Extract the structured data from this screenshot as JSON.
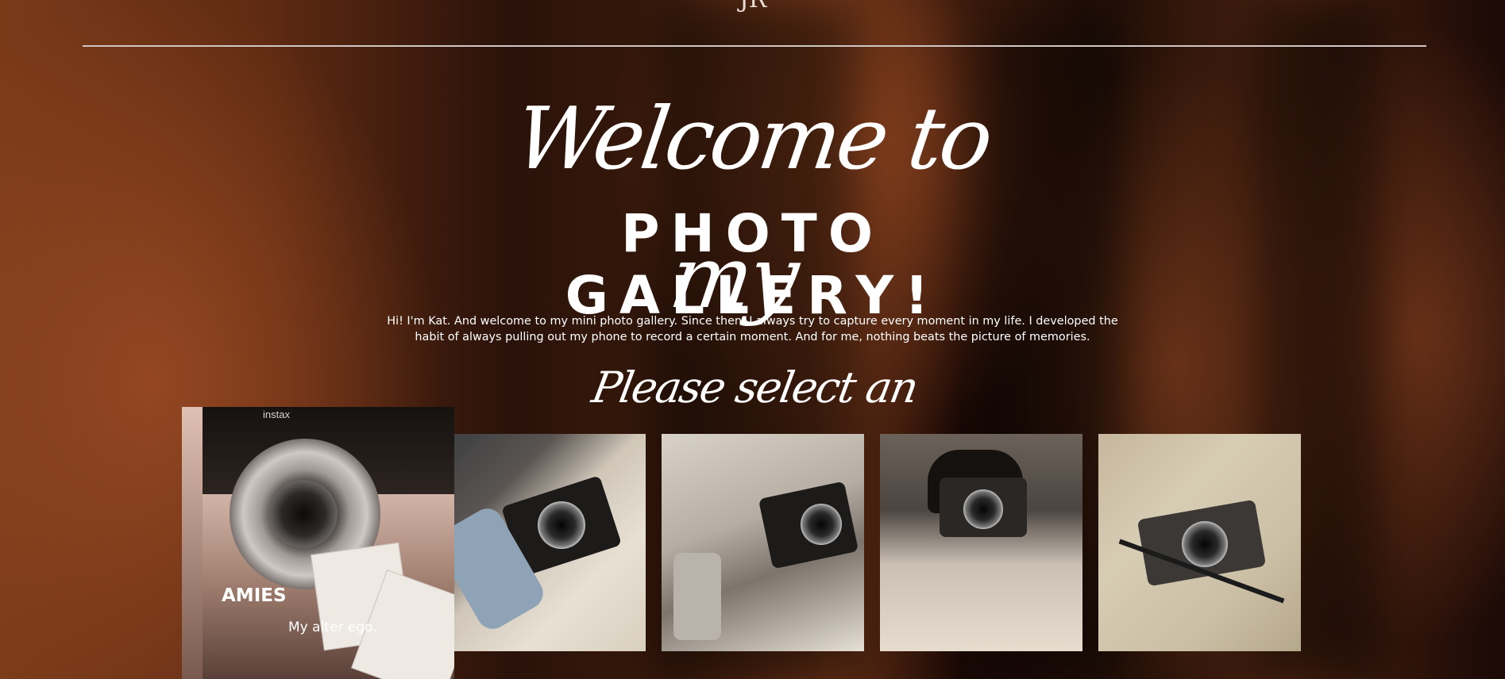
{
  "header": {
    "logo_text": "JR"
  },
  "hero": {
    "welcome": "Welcome to my",
    "title": "PHOTO GALLERY!",
    "intro": "Hi! I'm Kat. And welcome to my mini photo gallery. Since then, I always try to capture every moment in my life. I developed the habit of always pulling out my phone to record a certain moment. And for me, nothing beats the picture of memories."
  },
  "albums_section": {
    "heading": "Please select an album",
    "featured": {
      "name": "AMIES",
      "description": "My alter ego.",
      "camera_brand": "instax"
    }
  },
  "colors": {
    "accent_text": "#ffffff",
    "rule": "#cfc7c3"
  }
}
